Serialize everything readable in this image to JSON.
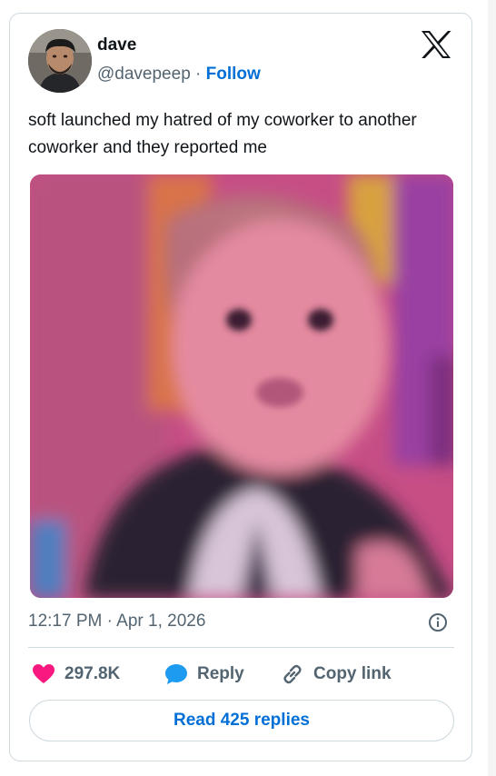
{
  "author": {
    "name": "dave",
    "handle": "@davepeep",
    "separator": "·",
    "follow_label": "Follow"
  },
  "tweet": {
    "text": "soft launched my hatred of my coworker to another coworker and they reported me",
    "timestamp": "12:17 PM · Apr 1, 2026"
  },
  "actions": {
    "like_count": "297.8K",
    "reply_label": "Reply",
    "copy_label": "Copy link"
  },
  "read_replies_label": "Read 425 replies",
  "icons": {
    "logo": "x-logo-icon",
    "info": "info-icon",
    "like": "heart-icon",
    "reply": "speech-bubble-icon",
    "copy": "link-icon"
  },
  "colors": {
    "link_blue": "#006fd6",
    "like_pink": "#f91880",
    "reply_blue": "#1d9bf0",
    "muted_text": "#536471",
    "border": "#cfd9de"
  }
}
